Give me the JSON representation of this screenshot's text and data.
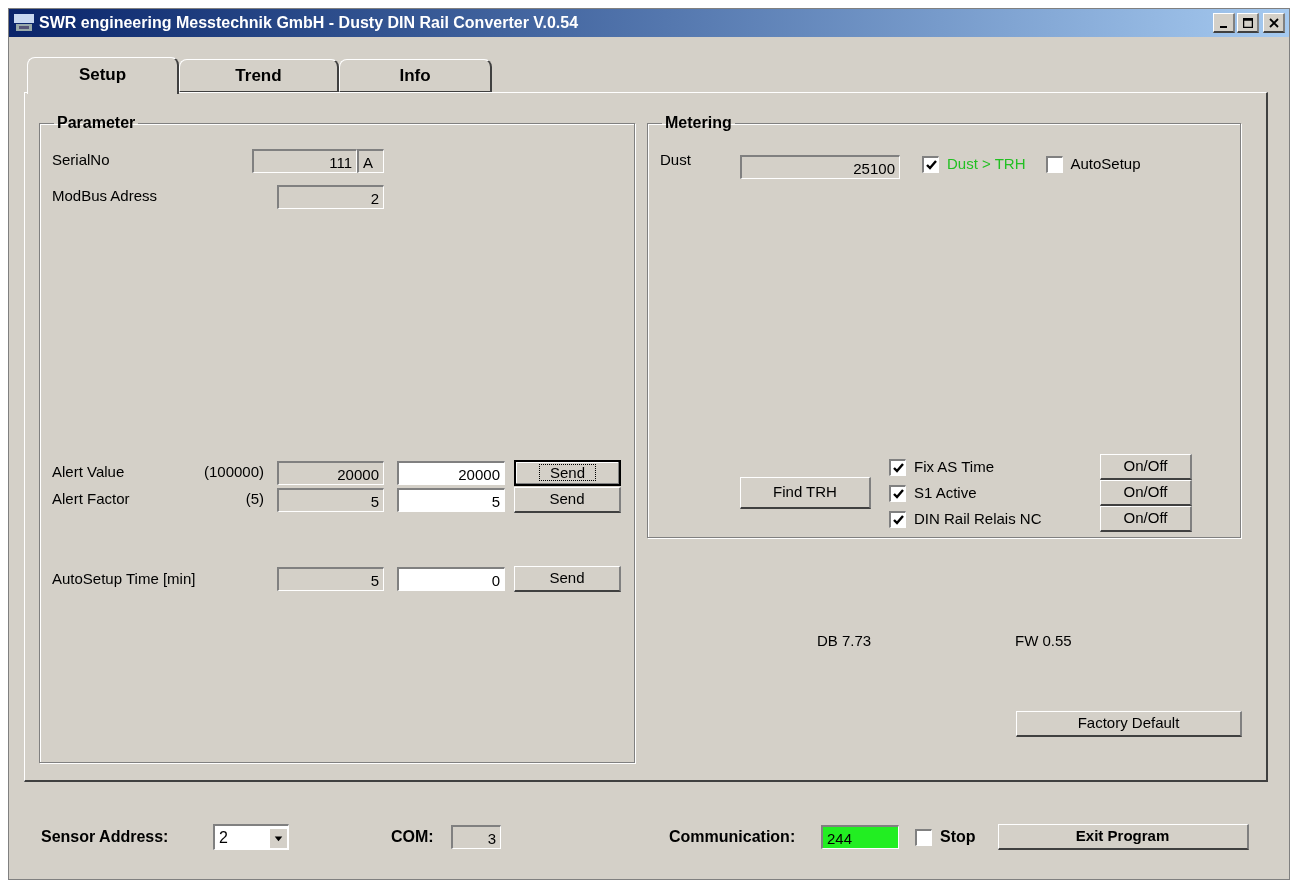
{
  "window": {
    "title": "SWR engineering Messtechnik GmbH - Dusty DIN Rail Converter V.0.54"
  },
  "tabs": [
    {
      "label": "Setup",
      "selected": true
    },
    {
      "label": "Trend",
      "selected": false
    },
    {
      "label": "Info",
      "selected": false
    }
  ],
  "parameter": {
    "title": "Parameter",
    "serial_no": {
      "label": "SerialNo",
      "value": "111",
      "suffix": "A"
    },
    "modbus": {
      "label": "ModBus Adress",
      "value": "2"
    },
    "settings": [
      {
        "label": "Alert Value",
        "range": "(100000)",
        "current": "20000",
        "input": "20000",
        "button": "Send",
        "focused": true
      },
      {
        "label": "Alert Factor",
        "range": "(5)",
        "current": "5",
        "input": "5",
        "button": "Send",
        "focused": false
      }
    ],
    "autosetup": {
      "label": "AutoSetup Time [min]",
      "current": "5",
      "input": "0",
      "button": "Send",
      "focused": false
    }
  },
  "metering": {
    "title": "Metering",
    "dust": {
      "label": "Dust",
      "value": "25100"
    },
    "flags": [
      {
        "label": "Dust > TRH",
        "checked": true,
        "color": "#22c022"
      },
      {
        "label": "AutoSetup",
        "checked": false,
        "color": "#000000"
      }
    ],
    "find_button": "Find TRH",
    "options": [
      {
        "label": "Fix AS Time",
        "checked": true,
        "button": "On/Off"
      },
      {
        "label": "S1 Active",
        "checked": true,
        "button": "On/Off"
      },
      {
        "label": "DIN Rail Relais NC",
        "checked": true,
        "button": "On/Off"
      }
    ]
  },
  "db_version": "DB 7.73",
  "fw_version": "FW 0.55",
  "factory_button": "Factory Default",
  "status": {
    "sensor_address": {
      "label": "Sensor Address:",
      "value": "2"
    },
    "com": {
      "label": "COM:",
      "value": "3"
    },
    "communication": {
      "label": "Communication:",
      "value": "244"
    },
    "stop": {
      "label": "Stop",
      "checked": false
    },
    "exit_button": "Exit Program"
  }
}
